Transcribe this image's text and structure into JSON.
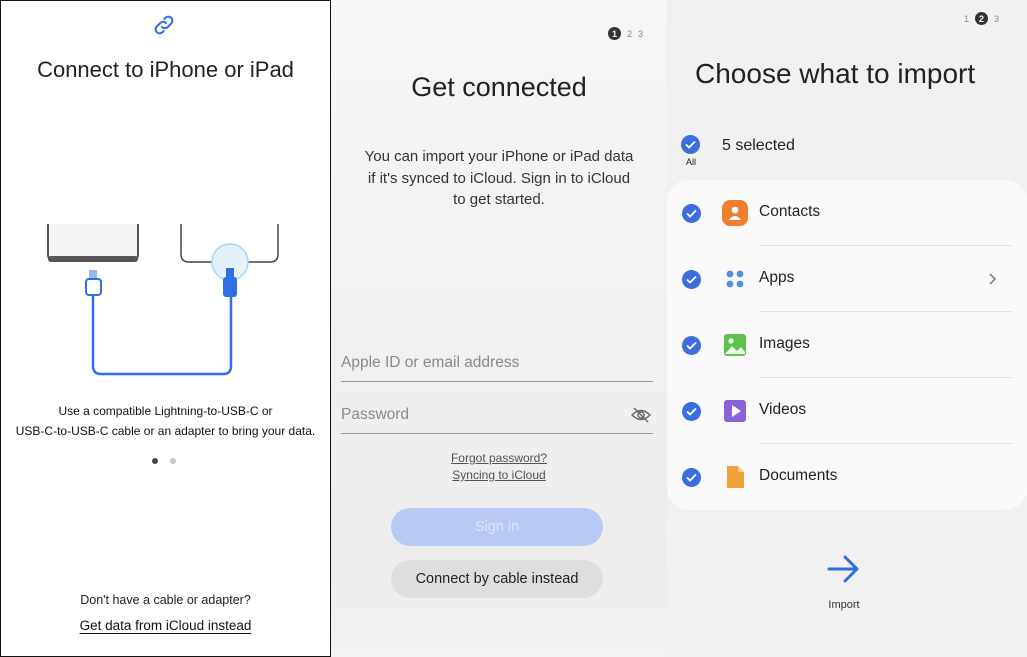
{
  "panel1": {
    "title": "Connect to iPhone or iPad",
    "caption_line1": "Use a compatible Lightning-to-USB-C or",
    "caption_line2": "USB-C-to-USB-C cable or an adapter to bring your data.",
    "question": "Don't have a cable or adapter?",
    "link": "Get data from iCloud instead",
    "page_indicator": {
      "active": 1,
      "total": 2
    },
    "link_icon": "link-icon"
  },
  "panel2": {
    "steps": [
      "1",
      "2",
      "3"
    ],
    "active_step": "1",
    "title": "Get connected",
    "description": "You can import your iPhone or iPad data if it's synced to iCloud. Sign in to iCloud to get started.",
    "apple_id_placeholder": "Apple ID or email address",
    "password_placeholder": "Password",
    "forgot_password": "Forgot password?",
    "syncing": "Syncing to iCloud",
    "sign_in": "Sign in",
    "connect_cable": "Connect by cable instead"
  },
  "panel3": {
    "steps": [
      "1",
      "2",
      "3"
    ],
    "active_step": "2",
    "title": "Choose what to import",
    "all_label": "All",
    "selected_text": "5 selected",
    "items": [
      {
        "label": "Contacts",
        "icon": "contacts-icon",
        "checked": true
      },
      {
        "label": "Apps",
        "icon": "apps-icon",
        "checked": true
      },
      {
        "label": "Images",
        "icon": "images-icon",
        "checked": true
      },
      {
        "label": "Videos",
        "icon": "videos-icon",
        "checked": true
      },
      {
        "label": "Documents",
        "icon": "documents-icon",
        "checked": true
      }
    ],
    "import_label": "Import",
    "accent_color": "#3c6ee0"
  }
}
